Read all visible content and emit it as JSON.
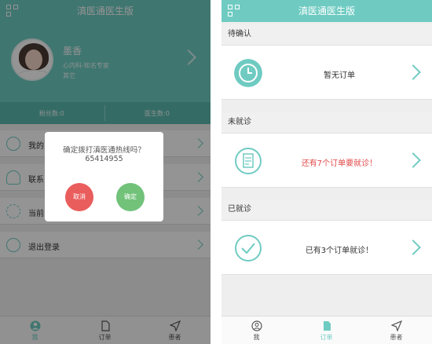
{
  "left": {
    "title": "滇医通医生版",
    "profile": {
      "name": "墨香",
      "dept": "心内科-知名专家",
      "other": "其它"
    },
    "stats": {
      "fans": "粉丝数:0",
      "doctors": "医生数:0"
    },
    "menu": [
      {
        "label": "我的",
        "icon": "clock-icon"
      },
      {
        "label": "联系",
        "icon": "headset-icon"
      },
      {
        "label": "当前",
        "icon": "refresh-icon"
      },
      {
        "label": "退出登录",
        "icon": "power-icon"
      }
    ],
    "dialog": {
      "message": "确定拨打滇医通热线吗？",
      "phone": "65414955",
      "cancel": "取消",
      "confirm": "确定"
    },
    "tabs": [
      {
        "label": "我"
      },
      {
        "label": "订单"
      },
      {
        "label": "患者"
      }
    ]
  },
  "right": {
    "title": "滇医通医生版",
    "sections": [
      {
        "header": "待确认",
        "text": "暂无订单",
        "icon": "clock-icon",
        "color": "#333333"
      },
      {
        "header": "未就诊",
        "text": "还有7个订单要就诊！",
        "icon": "document-icon",
        "color": "#e24848"
      },
      {
        "header": "已就诊",
        "text": "已有3个订单就诊！",
        "icon": "check-icon",
        "color": "#333333"
      }
    ],
    "tabs": [
      {
        "label": "我"
      },
      {
        "label": "订单"
      },
      {
        "label": "患者"
      }
    ]
  },
  "colors": {
    "teal": "#6fcbc2",
    "red": "#ea5d5d",
    "green": "#72c27a",
    "alert_text": "#e24848"
  }
}
